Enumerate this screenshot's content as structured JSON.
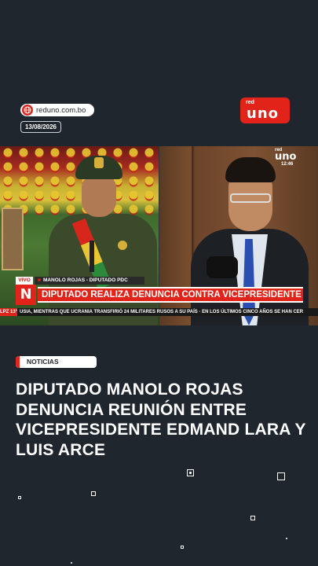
{
  "header": {
    "site": "reduno.com.bo",
    "date": "13/08/2026",
    "logo_small": "red",
    "logo_big": "uno"
  },
  "video": {
    "channel_small": "red",
    "channel_big": "uno",
    "time": "12:46",
    "live_label": "VIVO",
    "name_tag": "MANOLO ROJAS - DIPUTADO PDC",
    "network_letter": "N",
    "headline": "DIPUTADO REALIZA DENUNCIA CONTRA VICEPRESIDENTE",
    "ticker_city": "LPZ 13°",
    "ticker_text": "USIA, MIENTRAS QUE UCRANIA TRANSFIRIÓ 24 MILITARES RUSOS A SU PAÍS   ·   EN LOS ÚLTIMOS CINCO AÑOS SE HAN CER"
  },
  "article": {
    "category": "NOTICIAS",
    "title": "DIPUTADO MANOLO ROJAS DENUNCIA REUNIÓN ENTRE VICEPRESIDENTE EDMAND LARA Y LUIS ARCE"
  },
  "colors": {
    "background": "#1f262d",
    "accent": "#e2231a"
  },
  "icons": [
    "globe-icon",
    "redes-logo",
    "network-n-logo",
    "live-person-icon"
  ]
}
